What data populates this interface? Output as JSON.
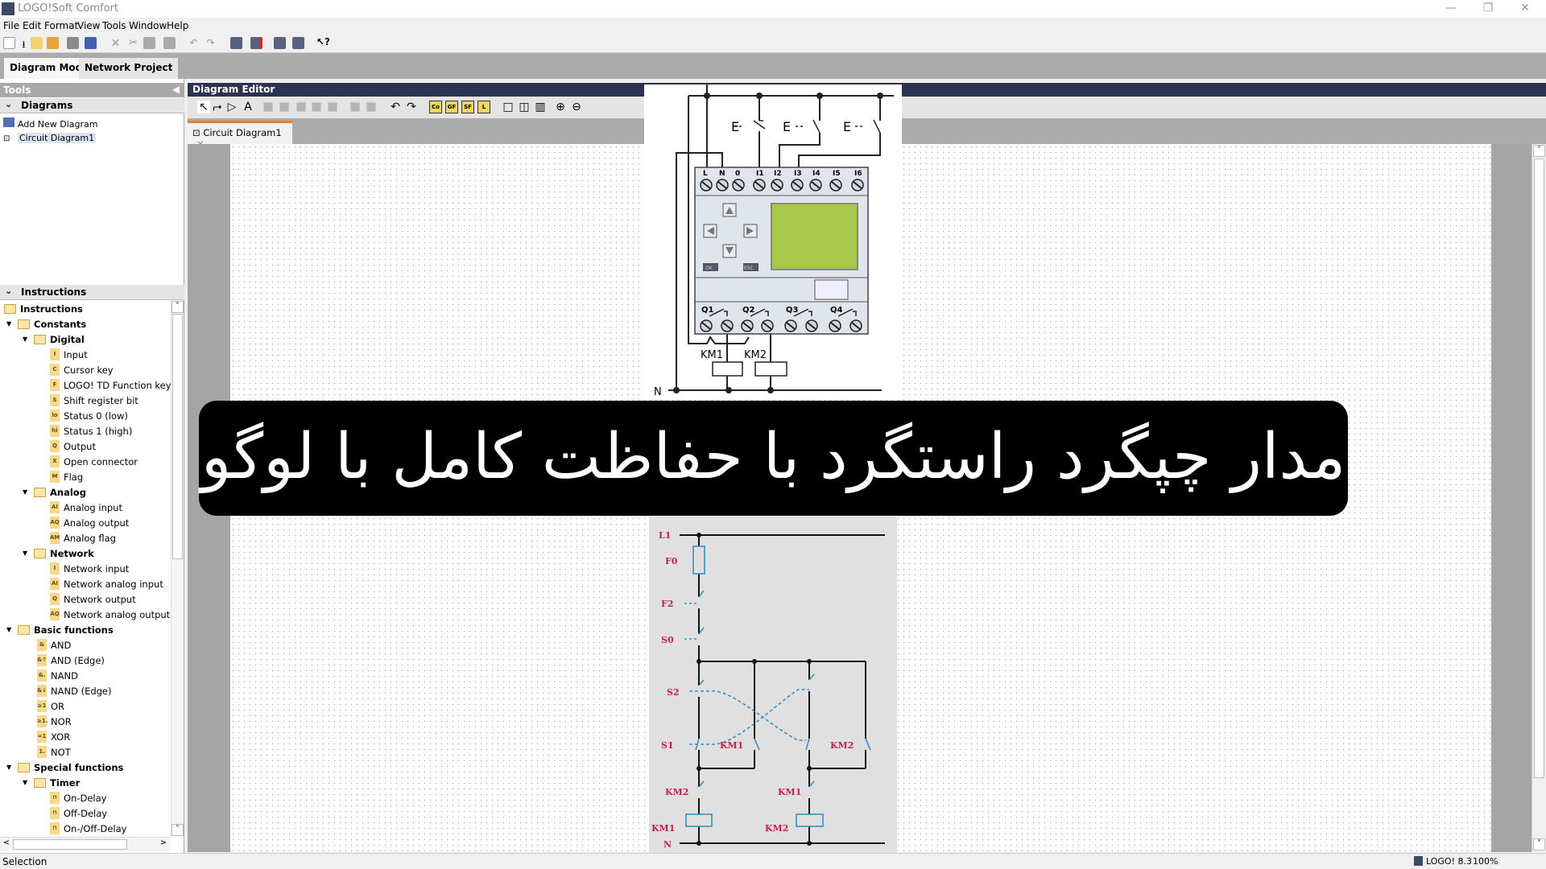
{
  "window": {
    "title": "LOGO!Soft Comfort",
    "minimize_icon": "minimize-icon",
    "restore_icon": "restore-icon",
    "close_icon": "close-icon"
  },
  "menu": [
    "File",
    "Edit",
    "Format",
    "View",
    "Tools",
    "Window",
    "Help"
  ],
  "toolbar_icons": [
    "new-icon",
    "download-icon",
    "open-icon",
    "open-folder-icon",
    "save-icon",
    "print-icon",
    "delete-icon",
    "cut-icon",
    "copy-icon",
    "paste-icon",
    "undo-icon",
    "redo-icon",
    "transfer-pc-plc-icon",
    "stop-plc-icon",
    "upload-icon",
    "download-plc-icon",
    "help-pointer-icon"
  ],
  "mode_tabs": [
    "Diagram Mode",
    "Network Project"
  ],
  "tools_panel": {
    "title": "Tools",
    "diagrams": {
      "header": "Diagrams",
      "items": [
        "Add New Diagram",
        "Circuit Diagram1"
      ]
    },
    "instructions": {
      "header": "Instructions"
    }
  },
  "tree": [
    {
      "label": "Instructions",
      "level": 0,
      "type": "folder"
    },
    {
      "label": "Constants",
      "level": 1,
      "type": "folder"
    },
    {
      "label": "Digital",
      "level": 2,
      "type": "folder"
    },
    {
      "label": "Input",
      "level": 3,
      "icon": "I"
    },
    {
      "label": "Cursor key",
      "level": 3,
      "icon": "C"
    },
    {
      "label": "LOGO! TD Function key",
      "level": 3,
      "icon": "F"
    },
    {
      "label": "Shift register bit",
      "level": 3,
      "icon": "S"
    },
    {
      "label": "Status 0 (low)",
      "level": 3,
      "icon": "lo"
    },
    {
      "label": "Status 1 (high)",
      "level": 3,
      "icon": "hi"
    },
    {
      "label": "Output",
      "level": 3,
      "icon": "Q"
    },
    {
      "label": "Open connector",
      "level": 3,
      "icon": "X"
    },
    {
      "label": "Flag",
      "level": 3,
      "icon": "M"
    },
    {
      "label": "Analog",
      "level": 2,
      "type": "folder"
    },
    {
      "label": "Analog input",
      "level": 3,
      "icon": "AI"
    },
    {
      "label": "Analog output",
      "level": 3,
      "icon": "AQ"
    },
    {
      "label": "Analog flag",
      "level": 3,
      "icon": "AM"
    },
    {
      "label": "Network",
      "level": 2,
      "type": "folder"
    },
    {
      "label": "Network input",
      "level": 3,
      "icon": "I"
    },
    {
      "label": "Network analog input",
      "level": 3,
      "icon": "AI"
    },
    {
      "label": "Network output",
      "level": 3,
      "icon": "Q"
    },
    {
      "label": "Network analog output",
      "level": 3,
      "icon": "AQ"
    },
    {
      "label": "Basic functions",
      "level": 1,
      "type": "folder"
    },
    {
      "label": "AND",
      "level": 2,
      "icon": "&"
    },
    {
      "label": "AND (Edge)",
      "level": 2,
      "icon": "&↑"
    },
    {
      "label": "NAND",
      "level": 2,
      "icon": "&."
    },
    {
      "label": "NAND (Edge)",
      "level": 2,
      "icon": "&↓"
    },
    {
      "label": "OR",
      "level": 2,
      "icon": "≥1"
    },
    {
      "label": "NOR",
      "level": 2,
      "icon": "≥1."
    },
    {
      "label": "XOR",
      "level": 2,
      "icon": "=1"
    },
    {
      "label": "NOT",
      "level": 2,
      "icon": "1."
    },
    {
      "label": "Special functions",
      "level": 1,
      "type": "folder"
    },
    {
      "label": "Timer",
      "level": 2,
      "type": "folder"
    },
    {
      "label": "On-Delay",
      "level": 3,
      "icon": "⊓"
    },
    {
      "label": "Off-Delay",
      "level": 3,
      "icon": "⊓"
    },
    {
      "label": "On-/Off-Delay",
      "level": 3,
      "icon": "⊓"
    }
  ],
  "editor": {
    "title": "Diagram Editor",
    "toolbar_icons": [
      "selection-icon",
      "connect-icon",
      "block-icon",
      "text-icon",
      "align-left-icon",
      "align-right-icon",
      "align-top-icon",
      "align-h-icon",
      "align-v-icon",
      "group-icon",
      "ungroup-icon",
      "undo-icon",
      "redo-icon",
      "constants-Co",
      "basic-functions-GF",
      "special-functions-SF",
      "udf-L",
      "single-view-icon",
      "split-view-icon",
      "triple-view-icon",
      "zoom-in-icon",
      "zoom-out-icon"
    ],
    "toolbar_badges": [
      "Co",
      "GF",
      "SF",
      "L"
    ],
    "tab": "Circuit Diagram1"
  },
  "plc_image": {
    "top_terminals": [
      "L",
      "N",
      "0",
      "I1",
      "I2",
      "I3",
      "I4",
      "I5",
      "I6"
    ],
    "outputs": [
      "Q1",
      "Q2",
      "Q3",
      "Q4"
    ],
    "buttons": [
      "OK",
      "ESC"
    ],
    "switch_label": "E",
    "coils": [
      "KM1",
      "KM2"
    ],
    "neutral": "N",
    "display_color": "#a8c84a"
  },
  "banner": {
    "text": "مدار چپگرد راستگرد با حفاظت کامل با لوگو"
  },
  "ladder_image": {
    "L1": "L1",
    "N": "N",
    "F0": "F0",
    "F2": "F2",
    "S0": "S0",
    "S2": "S2",
    "S1": "S1",
    "km1_hold": "KM1",
    "km2_hold": "KM2",
    "km2_interlock": "KM2",
    "km1_interlock": "KM1",
    "coil1": "KM1",
    "coil2": "KM2",
    "label_color": "#c21f4a",
    "contact_color": "#3a8fc0"
  },
  "status": {
    "mode": "Selection",
    "device": "LOGO! 8.3",
    "zoom": "100%"
  }
}
